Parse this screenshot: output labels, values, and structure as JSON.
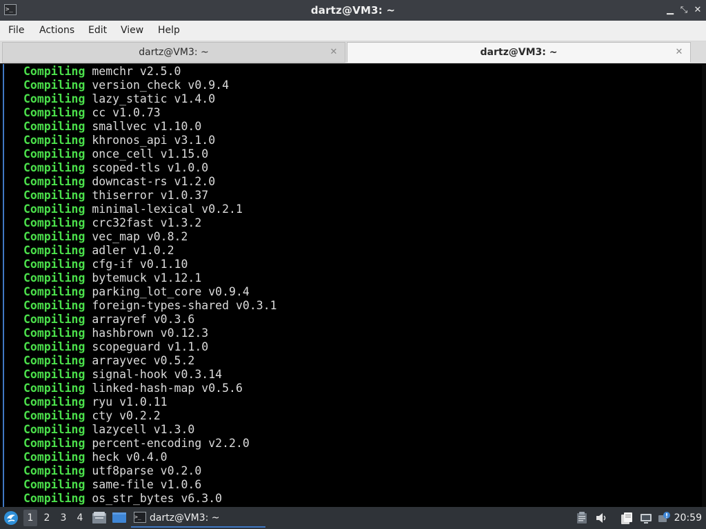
{
  "window": {
    "title": "dartz@VM3: ~",
    "app_icon_glyph": ">_",
    "minimize_glyph": "▁",
    "restore_glyph": "⤡",
    "close_glyph": "✕"
  },
  "menu": {
    "file": "File",
    "actions": "Actions",
    "edit": "Edit",
    "view": "View",
    "help": "Help"
  },
  "tabs": [
    {
      "label": "dartz@VM3: ~",
      "close_glyph": "✕",
      "active": false
    },
    {
      "label": "dartz@VM3: ~",
      "close_glyph": "✕",
      "active": true
    }
  ],
  "terminal": {
    "background": "#000000",
    "keyword_color": "#4be04b",
    "text_color": "#dcdcdc",
    "lines": [
      {
        "kw": "Compiling",
        "text": "memchr v2.5.0"
      },
      {
        "kw": "Compiling",
        "text": "version_check v0.9.4"
      },
      {
        "kw": "Compiling",
        "text": "lazy_static v1.4.0"
      },
      {
        "kw": "Compiling",
        "text": "cc v1.0.73"
      },
      {
        "kw": "Compiling",
        "text": "smallvec v1.10.0"
      },
      {
        "kw": "Compiling",
        "text": "khronos_api v3.1.0"
      },
      {
        "kw": "Compiling",
        "text": "once_cell v1.15.0"
      },
      {
        "kw": "Compiling",
        "text": "scoped-tls v1.0.0"
      },
      {
        "kw": "Compiling",
        "text": "downcast-rs v1.2.0"
      },
      {
        "kw": "Compiling",
        "text": "thiserror v1.0.37"
      },
      {
        "kw": "Compiling",
        "text": "minimal-lexical v0.2.1"
      },
      {
        "kw": "Compiling",
        "text": "crc32fast v1.3.2"
      },
      {
        "kw": "Compiling",
        "text": "vec_map v0.8.2"
      },
      {
        "kw": "Compiling",
        "text": "adler v1.0.2"
      },
      {
        "kw": "Compiling",
        "text": "cfg-if v0.1.10"
      },
      {
        "kw": "Compiling",
        "text": "bytemuck v1.12.1"
      },
      {
        "kw": "Compiling",
        "text": "parking_lot_core v0.9.4"
      },
      {
        "kw": "Compiling",
        "text": "foreign-types-shared v0.3.1"
      },
      {
        "kw": "Compiling",
        "text": "arrayref v0.3.6"
      },
      {
        "kw": "Compiling",
        "text": "hashbrown v0.12.3"
      },
      {
        "kw": "Compiling",
        "text": "scopeguard v1.1.0"
      },
      {
        "kw": "Compiling",
        "text": "arrayvec v0.5.2"
      },
      {
        "kw": "Compiling",
        "text": "signal-hook v0.3.14"
      },
      {
        "kw": "Compiling",
        "text": "linked-hash-map v0.5.6"
      },
      {
        "kw": "Compiling",
        "text": "ryu v1.0.11"
      },
      {
        "kw": "Compiling",
        "text": "cty v0.2.2"
      },
      {
        "kw": "Compiling",
        "text": "lazycell v1.3.0"
      },
      {
        "kw": "Compiling",
        "text": "percent-encoding v2.2.0"
      },
      {
        "kw": "Compiling",
        "text": "heck v0.4.0"
      },
      {
        "kw": "Compiling",
        "text": "utf8parse v0.2.0"
      },
      {
        "kw": "Compiling",
        "text": "same-file v1.0.6"
      },
      {
        "kw": "Compiling",
        "text": "os_str_bytes v6.3.0"
      }
    ]
  },
  "taskbar": {
    "workspaces": [
      "1",
      "2",
      "3",
      "4"
    ],
    "active_workspace": "1",
    "task": {
      "label": "dartz@VM3: ~",
      "icon_glyph": ">_"
    },
    "clock": "20:59",
    "accent": "#3f78c4"
  }
}
